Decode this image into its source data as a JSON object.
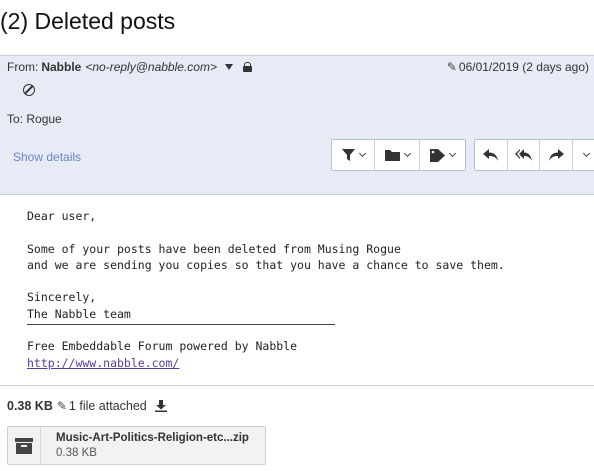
{
  "message": {
    "subject": "(2) Deleted posts",
    "from_label": "From:",
    "sender_name": "Nabble",
    "sender_email": "<no-reply@nabble.com>",
    "date": "06/01/2019 (2 days ago)",
    "to_label": "To:",
    "recipient": "Rogue",
    "show_details": "Show details"
  },
  "toolbar": {
    "buttons": [
      "filter-icon",
      "folder-icon",
      "tag-icon",
      "reply-icon",
      "reply-all-icon",
      "forward-icon",
      "more-icon"
    ]
  },
  "body": {
    "lines": [
      "Dear user,",
      "",
      "Some of your posts have been deleted from Musing Rogue",
      "and we are sending you copies so that you have a chance to save them.",
      "",
      "Sincerely,",
      "The Nabble team"
    ],
    "signature_line": "Free Embeddable Forum powered by Nabble",
    "signature_link": "http://www.nabble.com/"
  },
  "attachments": {
    "total_size": "0.38 KB",
    "count_text": "1 file attached",
    "files": [
      {
        "name": "Music-Art-Politics-Religion-etc...zip",
        "size": "0.38 KB",
        "icon": "archive-icon"
      }
    ]
  },
  "colors": {
    "header_bg": "#e6ebf5",
    "link": "#6a84c9",
    "signature_link": "#5a3b9c"
  }
}
